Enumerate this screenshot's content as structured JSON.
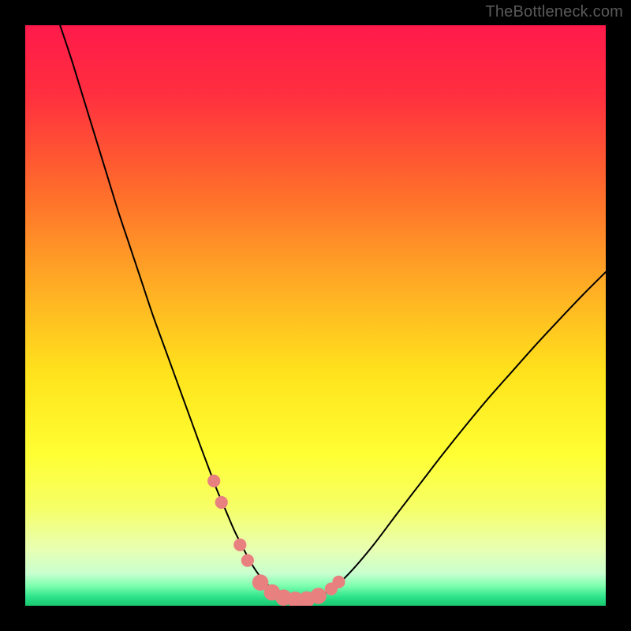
{
  "watermark": "TheBottleneck.com",
  "plot": {
    "inner_x": 32,
    "inner_y": 32,
    "inner_w": 736,
    "inner_h": 736
  },
  "gradient_stops": [
    {
      "offset": 0.0,
      "color": "#ff1a4b"
    },
    {
      "offset": 0.12,
      "color": "#ff2f3f"
    },
    {
      "offset": 0.28,
      "color": "#ff6a2c"
    },
    {
      "offset": 0.45,
      "color": "#ffad24"
    },
    {
      "offset": 0.6,
      "color": "#ffe31c"
    },
    {
      "offset": 0.74,
      "color": "#ffff33"
    },
    {
      "offset": 0.83,
      "color": "#f6ff66"
    },
    {
      "offset": 0.9,
      "color": "#e9ffb0"
    },
    {
      "offset": 0.945,
      "color": "#c8ffd0"
    },
    {
      "offset": 0.965,
      "color": "#7fffaf"
    },
    {
      "offset": 0.985,
      "color": "#2de38a"
    },
    {
      "offset": 1.0,
      "color": "#18c76e"
    }
  ],
  "colors": {
    "curve": "#000000",
    "marker_fill": "#e98080",
    "marker_stroke": "#d46060"
  },
  "chart_data": {
    "type": "line",
    "title": "",
    "xlabel": "",
    "ylabel": "",
    "xlim": [
      0,
      100
    ],
    "ylim": [
      0,
      100
    ],
    "series": [
      {
        "name": "curve",
        "x": [
          6,
          8,
          10,
          12,
          14,
          16,
          18,
          20,
          22,
          24,
          26,
          28,
          30,
          31.5,
          33,
          34.5,
          36,
          37.5,
          39,
          40.5,
          42,
          44,
          46,
          48,
          50,
          53,
          56,
          60,
          64,
          68,
          72,
          76,
          80,
          84,
          88,
          92,
          96,
          100
        ],
        "y": [
          100,
          94,
          87.5,
          81,
          74.5,
          68,
          62,
          56,
          50,
          44.5,
          39,
          33.5,
          28,
          24,
          20,
          16.5,
          13,
          10,
          7.2,
          5,
          3.4,
          2.1,
          1.3,
          1.0,
          1.4,
          3.0,
          5.8,
          10.5,
          15.8,
          21.0,
          26.2,
          31.2,
          36.0,
          40.5,
          45.0,
          49.3,
          53.5,
          57.5
        ]
      }
    ],
    "markers": [
      {
        "x": 32.5,
        "y": 21.5
      },
      {
        "x": 33.8,
        "y": 17.8
      },
      {
        "x": 37.0,
        "y": 10.5
      },
      {
        "x": 38.3,
        "y": 7.8
      },
      {
        "x": 40.5,
        "y": 4.0,
        "r": 1.4
      },
      {
        "x": 42.5,
        "y": 2.3,
        "r": 1.4
      },
      {
        "x": 44.5,
        "y": 1.4,
        "r": 1.4
      },
      {
        "x": 46.5,
        "y": 1.05,
        "r": 1.4
      },
      {
        "x": 48.5,
        "y": 1.1,
        "r": 1.4
      },
      {
        "x": 50.5,
        "y": 1.7,
        "r": 1.4
      },
      {
        "x": 52.7,
        "y": 2.9
      },
      {
        "x": 54.0,
        "y": 4.1
      }
    ],
    "marker_default_r": 1.1
  }
}
